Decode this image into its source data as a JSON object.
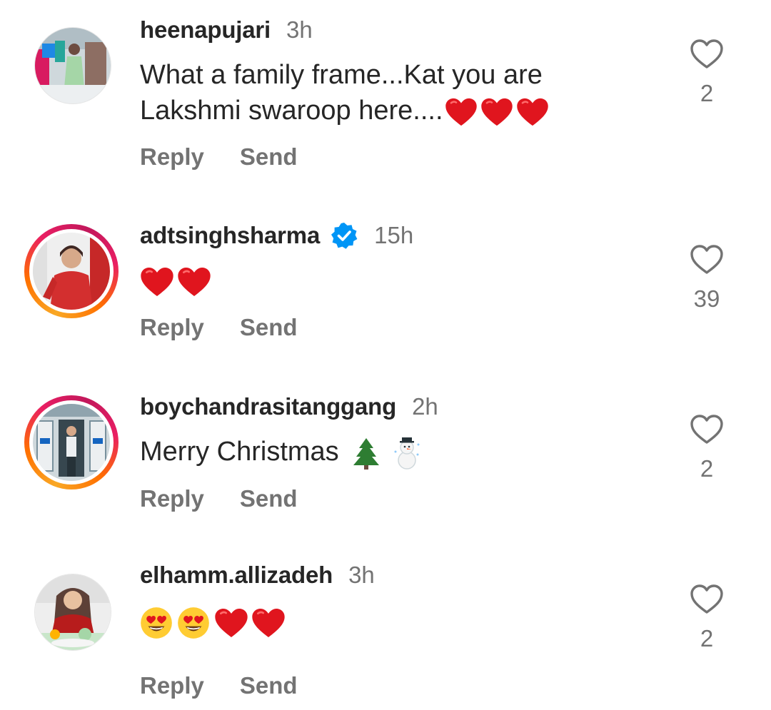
{
  "comments": [
    {
      "username": "heenapujari",
      "time": "3h",
      "text": "What a family frame...Kat you are Lakshmi swaroop here....❤️❤️❤️",
      "text_parts": [
        "What a family frame...Kat you are",
        "Lakshmi swaroop here...."
      ],
      "verified": false,
      "story_ring": false,
      "likes": "2",
      "reply_label": "Reply",
      "send_label": "Send"
    },
    {
      "username": "adtsinghsharma",
      "time": "15h",
      "text": "❤️❤️",
      "verified": true,
      "story_ring": true,
      "likes": "39",
      "reply_label": "Reply",
      "send_label": "Send"
    },
    {
      "username": "boychandrasitanggang",
      "time": "2h",
      "text": "Merry Christmas 🌲☃️",
      "text_parts": [
        "Merry Christmas"
      ],
      "verified": false,
      "story_ring": true,
      "likes": "2",
      "reply_label": "Reply",
      "send_label": "Send"
    },
    {
      "username": "elhamm.allizadeh",
      "time": "3h",
      "text": "😍😍❤️❤️",
      "verified": false,
      "story_ring": false,
      "likes": "2",
      "reply_label": "Reply",
      "send_label": "Send"
    }
  ],
  "icons": {
    "like": "heart-outline-icon",
    "verified": "verified-badge-icon"
  },
  "colors": {
    "text": "#262626",
    "secondary": "#737373",
    "verified_blue": "#0095f6",
    "heart_red": "#e0151e"
  }
}
